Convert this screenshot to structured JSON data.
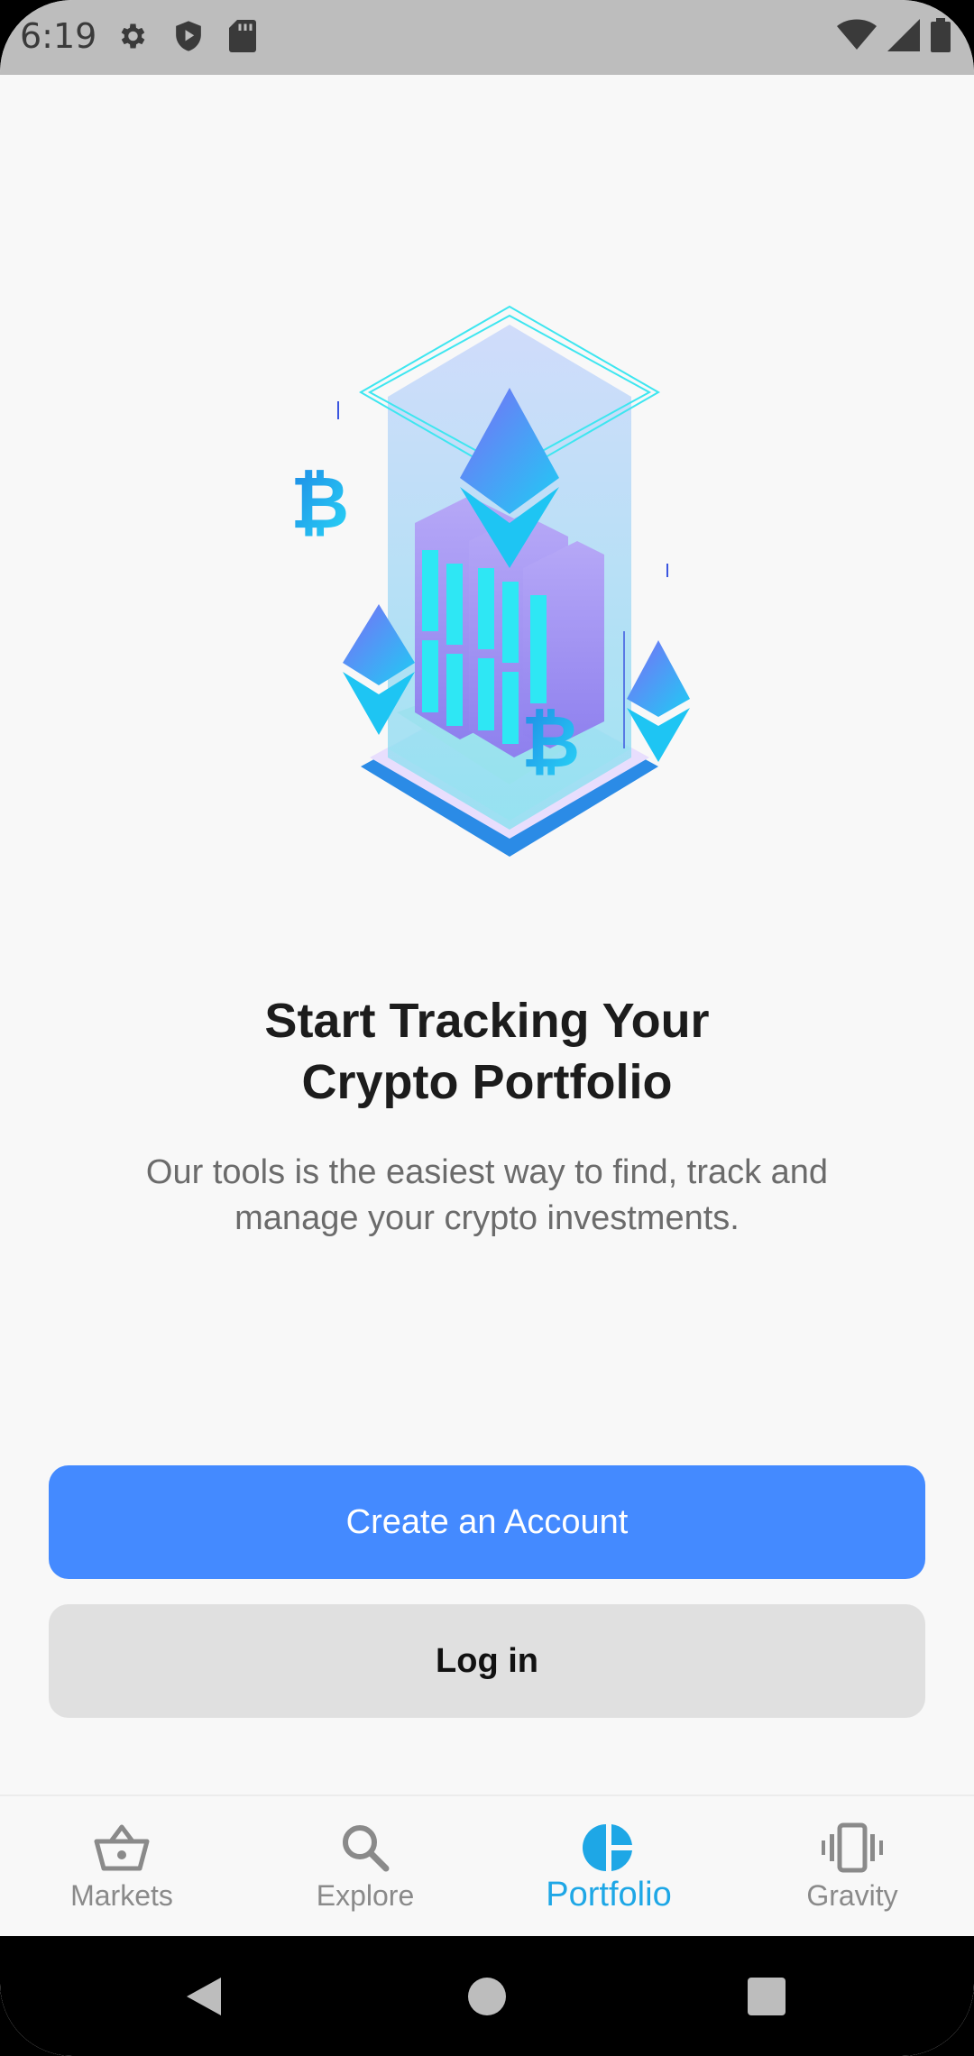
{
  "status_bar": {
    "time": "6:19",
    "left_icons": [
      "gear-icon",
      "shield-icon",
      "sd-card-icon"
    ],
    "right_icons": [
      "wifi-icon",
      "signal-icon",
      "battery-icon"
    ]
  },
  "onboarding": {
    "illustration": "crypto-tower-illustration",
    "headline_line1": "Start Tracking Your",
    "headline_line2": "Crypto Portfolio",
    "subtext": "Our tools is the easiest way to find, track and manage your crypto investments."
  },
  "actions": {
    "create_account_label": "Create an Account",
    "login_label": "Log in"
  },
  "bottom_nav": {
    "active": "Portfolio",
    "items": [
      {
        "label": "Markets",
        "icon": "basket-icon"
      },
      {
        "label": "Explore",
        "icon": "search-icon"
      },
      {
        "label": "Portfolio",
        "icon": "pie-chart-icon"
      },
      {
        "label": "Gravity",
        "icon": "vibration-icon"
      }
    ]
  },
  "colors": {
    "primary": "#448aff",
    "active_nav": "#1ea7e6",
    "secondary_button": "#e0e0e0",
    "background": "#f8f8f8"
  }
}
